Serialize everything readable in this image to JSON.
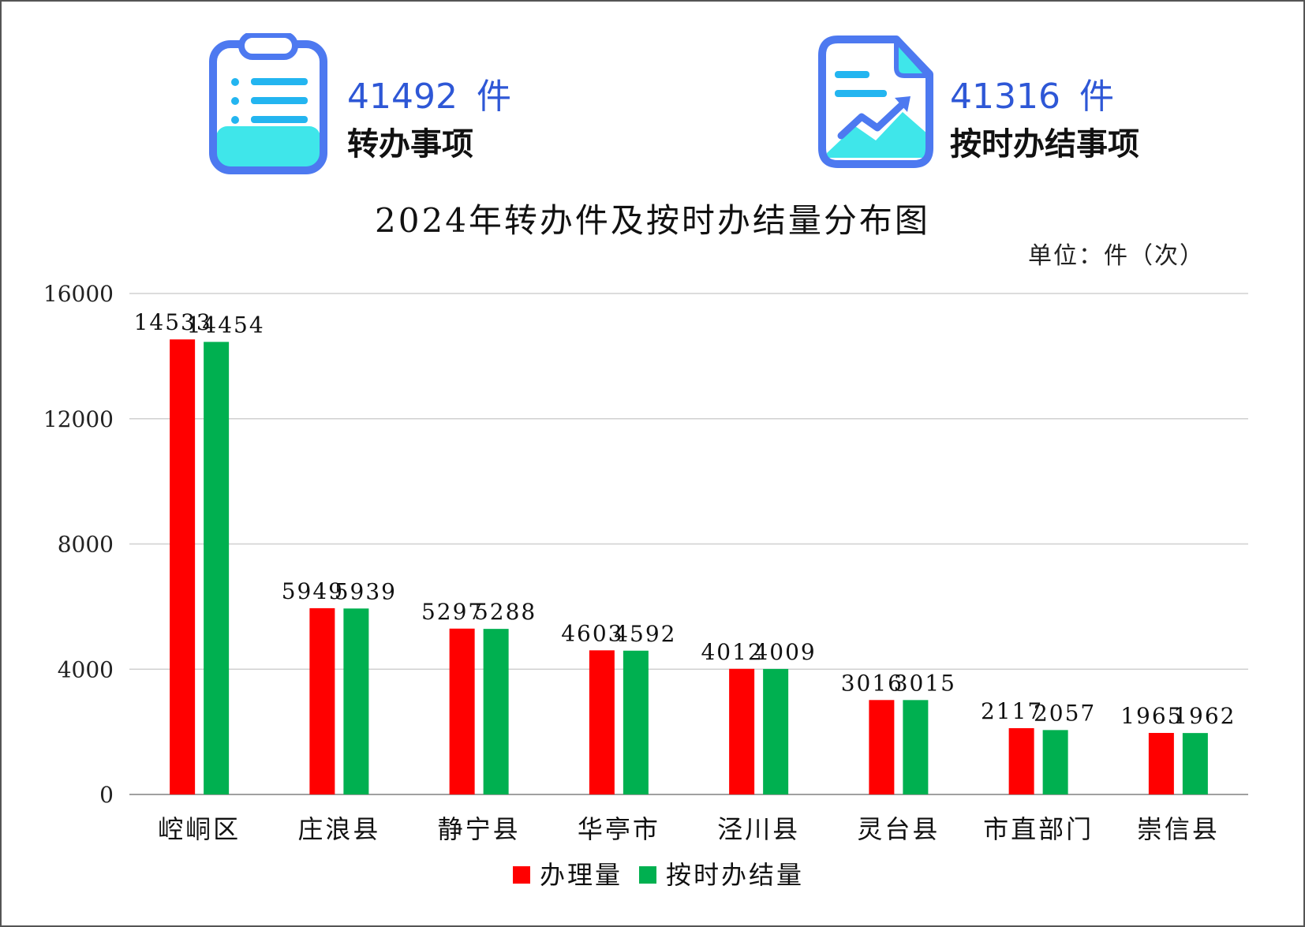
{
  "stats": [
    {
      "number": "41492",
      "unit": "件",
      "label": "转办事项",
      "icon": "clipboard-list-icon"
    },
    {
      "number": "41316",
      "unit": "件",
      "label": "按时办结事项",
      "icon": "document-trend-chart-icon"
    }
  ],
  "colors": {
    "accent_blue": "#2e57d6",
    "icon_blue": "#4d79f0",
    "icon_cyan": "#3fe6ea",
    "icon_line": "#23b5f0",
    "series_processed": "#ff0000",
    "series_completed": "#00b050",
    "grid": "#d0d0d0"
  },
  "chart_data": {
    "type": "bar",
    "title": "2024年转办件及按时办结量分布图",
    "unit_label": "单位：件（次）",
    "categories": [
      "崆峒区",
      "庄浪县",
      "静宁县",
      "华亭市",
      "泾川县",
      "灵台县",
      "市直部门",
      "崇信县"
    ],
    "series": [
      {
        "name": "办理量",
        "values": [
          14533,
          5949,
          5297,
          4603,
          4012,
          3016,
          2117,
          1965
        ]
      },
      {
        "name": "按时办结量",
        "values": [
          14454,
          5939,
          5288,
          4592,
          4009,
          3015,
          2057,
          1962
        ]
      }
    ],
    "ylim": [
      0,
      16000
    ],
    "yticks": [
      0,
      4000,
      8000,
      12000,
      16000
    ],
    "grid": true,
    "legend_position": "bottom-center"
  }
}
